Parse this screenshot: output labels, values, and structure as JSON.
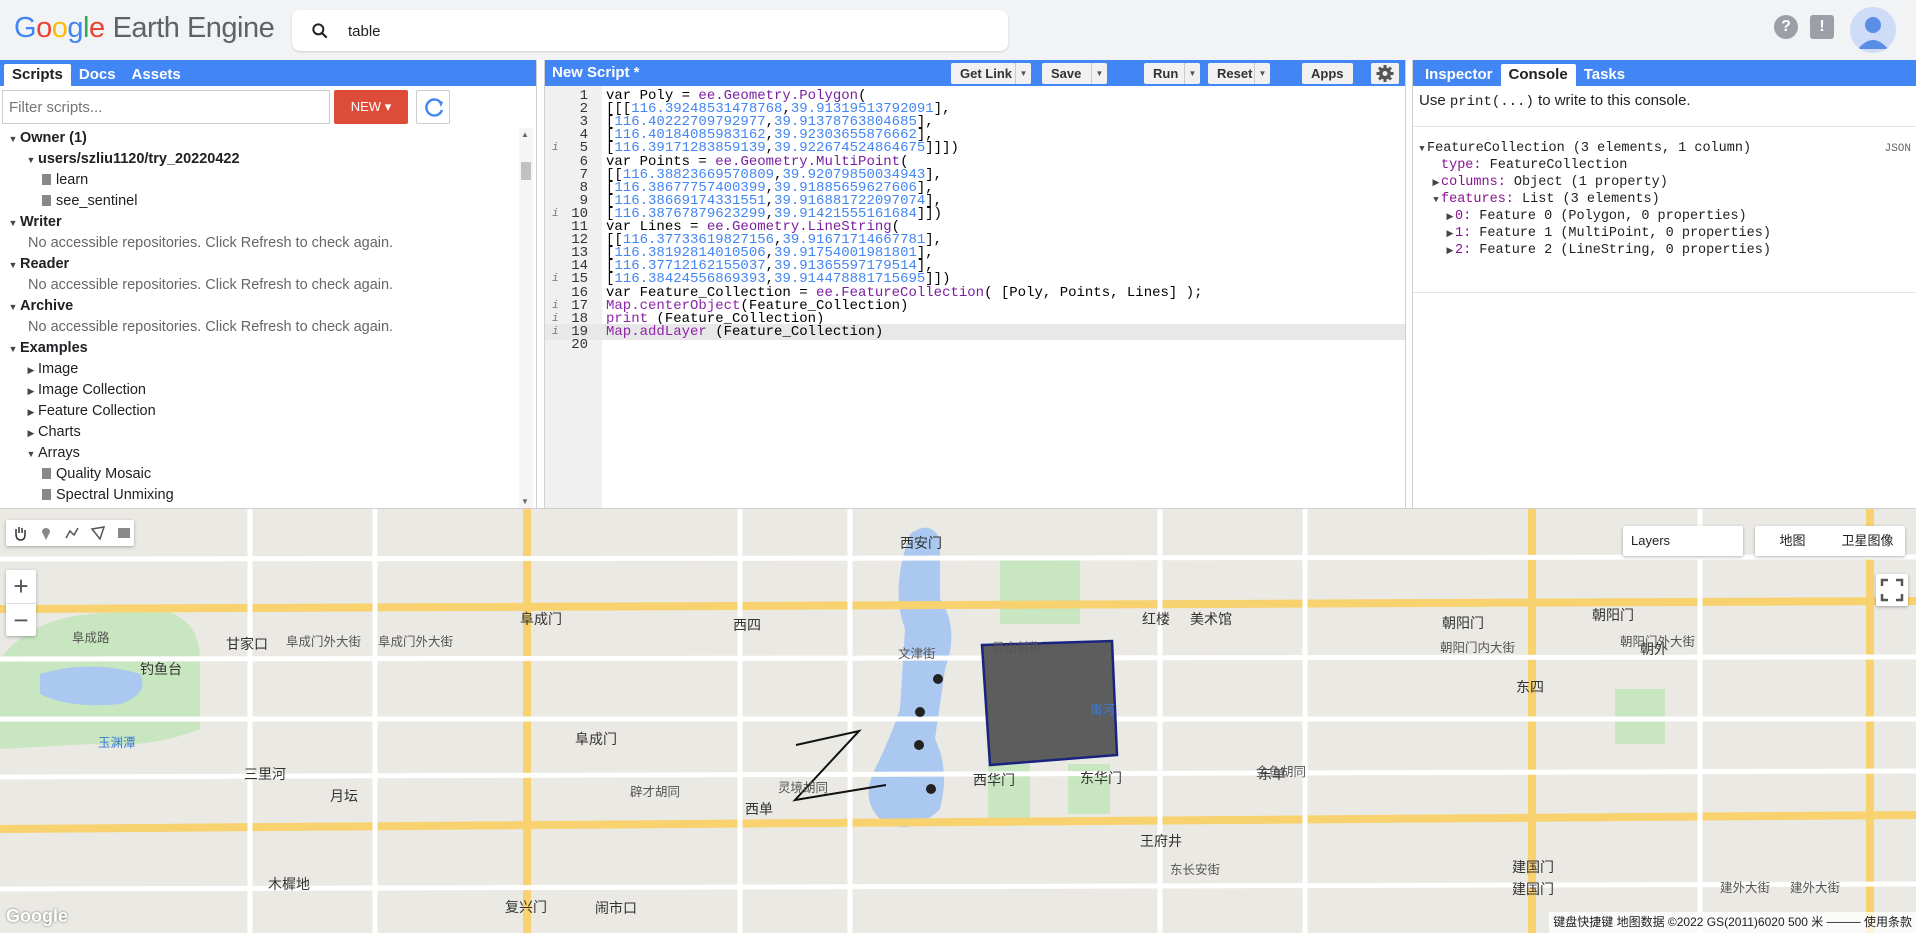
{
  "header": {
    "logo_google": [
      "G",
      "o",
      "o",
      "g",
      "l",
      "e"
    ],
    "logo_product": "Earth Engine",
    "search_value": "table"
  },
  "left_panel": {
    "tabs": [
      "Scripts",
      "Docs",
      "Assets"
    ],
    "filter_placeholder": "Filter scripts...",
    "new_button": "NEW",
    "tree": [
      {
        "label": "Owner (1)",
        "level": 0,
        "icon": "open",
        "bold": true
      },
      {
        "label": "users/szliu1120/try_20220422",
        "level": 1,
        "icon": "open",
        "bold": true
      },
      {
        "label": "learn",
        "level": 2,
        "icon": "file"
      },
      {
        "label": "see_sentinel",
        "level": 2,
        "icon": "file"
      },
      {
        "label": "Writer",
        "level": 0,
        "icon": "open",
        "bold": true
      },
      {
        "label": "No accessible repositories. Click Refresh to check again.",
        "level": 1,
        "icon": "none",
        "muted": true
      },
      {
        "label": "Reader",
        "level": 0,
        "icon": "open",
        "bold": true
      },
      {
        "label": "No accessible repositories. Click Refresh to check again.",
        "level": 1,
        "icon": "none",
        "muted": true
      },
      {
        "label": "Archive",
        "level": 0,
        "icon": "open",
        "bold": true
      },
      {
        "label": "No accessible repositories. Click Refresh to check again.",
        "level": 1,
        "icon": "none",
        "muted": true
      },
      {
        "label": "Examples",
        "level": 0,
        "icon": "open",
        "bold": true
      },
      {
        "label": "Image",
        "level": 1,
        "icon": "closed"
      },
      {
        "label": "Image Collection",
        "level": 1,
        "icon": "closed"
      },
      {
        "label": "Feature Collection",
        "level": 1,
        "icon": "closed"
      },
      {
        "label": "Charts",
        "level": 1,
        "icon": "closed"
      },
      {
        "label": "Arrays",
        "level": 1,
        "icon": "open"
      },
      {
        "label": "Quality Mosaic",
        "level": 2,
        "icon": "file"
      },
      {
        "label": "Spectral Unmixing",
        "level": 2,
        "icon": "file"
      }
    ]
  },
  "editor": {
    "title": "New Script *",
    "buttons": {
      "get_link": "Get Link",
      "save": "Save",
      "run": "Run",
      "reset": "Reset",
      "apps": "Apps"
    },
    "lines": [
      {
        "n": "1",
        "info": false,
        "segs": [
          [
            "kw",
            "var "
          ],
          [
            "txt",
            "Poly = "
          ],
          [
            "purple",
            "ee.Geometry.Polygon"
          ],
          [
            "txt",
            "("
          ]
        ]
      },
      {
        "n": "2",
        "info": false,
        "segs": [
          [
            "txt",
            "[[["
          ],
          [
            "blue",
            "116.39248531478768"
          ],
          [
            "txt",
            ","
          ],
          [
            "blue",
            "39.91319513792091"
          ],
          [
            "txt",
            "],"
          ]
        ]
      },
      {
        "n": "3",
        "info": false,
        "segs": [
          [
            "txt",
            "["
          ],
          [
            "blue",
            "116.40222709792977"
          ],
          [
            "txt",
            ","
          ],
          [
            "blue",
            "39.91378763804685"
          ],
          [
            "txt",
            "],"
          ]
        ]
      },
      {
        "n": "4",
        "info": false,
        "segs": [
          [
            "txt",
            "["
          ],
          [
            "blue",
            "116.40184085983162"
          ],
          [
            "txt",
            ","
          ],
          [
            "blue",
            "39.92303655876662"
          ],
          [
            "txt",
            "],"
          ]
        ]
      },
      {
        "n": "5",
        "info": true,
        "segs": [
          [
            "txt",
            "["
          ],
          [
            "blue",
            "116.39171283859139"
          ],
          [
            "txt",
            ","
          ],
          [
            "blue",
            "39.922674524864675"
          ],
          [
            "txt",
            "]]])"
          ]
        ]
      },
      {
        "n": "6",
        "info": false,
        "segs": [
          [
            "kw",
            "var "
          ],
          [
            "txt",
            "Points = "
          ],
          [
            "purple",
            "ee.Geometry.MultiPoint"
          ],
          [
            "txt",
            "("
          ]
        ]
      },
      {
        "n": "7",
        "info": false,
        "segs": [
          [
            "txt",
            "[["
          ],
          [
            "blue",
            "116.38823669570809"
          ],
          [
            "txt",
            ","
          ],
          [
            "blue",
            "39.92079850034943"
          ],
          [
            "txt",
            "],"
          ]
        ]
      },
      {
        "n": "8",
        "info": false,
        "segs": [
          [
            "txt",
            "["
          ],
          [
            "blue",
            "116.38677757400399"
          ],
          [
            "txt",
            ","
          ],
          [
            "blue",
            "39.91885659627606"
          ],
          [
            "txt",
            "],"
          ]
        ]
      },
      {
        "n": "9",
        "info": false,
        "segs": [
          [
            "txt",
            "["
          ],
          [
            "blue",
            "116.38669174331551"
          ],
          [
            "txt",
            ","
          ],
          [
            "blue",
            "39.916881722097074"
          ],
          [
            "txt",
            "],"
          ]
        ]
      },
      {
        "n": "10",
        "info": true,
        "segs": [
          [
            "txt",
            "["
          ],
          [
            "blue",
            "116.38767879623299"
          ],
          [
            "txt",
            ","
          ],
          [
            "blue",
            "39.91421555161684"
          ],
          [
            "txt",
            "]])"
          ]
        ]
      },
      {
        "n": "11",
        "info": false,
        "segs": [
          [
            "kw",
            "var "
          ],
          [
            "txt",
            "Lines = "
          ],
          [
            "purple",
            "ee.Geometry.LineString"
          ],
          [
            "txt",
            "("
          ]
        ]
      },
      {
        "n": "12",
        "info": false,
        "segs": [
          [
            "txt",
            "[["
          ],
          [
            "blue",
            "116.37733619827156"
          ],
          [
            "txt",
            ","
          ],
          [
            "blue",
            "39.91671714667781"
          ],
          [
            "txt",
            "],"
          ]
        ]
      },
      {
        "n": "13",
        "info": false,
        "segs": [
          [
            "txt",
            "["
          ],
          [
            "blue",
            "116.38192814010506"
          ],
          [
            "txt",
            ","
          ],
          [
            "blue",
            "39.91754001981801"
          ],
          [
            "txt",
            "],"
          ]
        ]
      },
      {
        "n": "14",
        "info": false,
        "segs": [
          [
            "txt",
            "["
          ],
          [
            "blue",
            "116.37712162155037"
          ],
          [
            "txt",
            ","
          ],
          [
            "blue",
            "39.91365597179514"
          ],
          [
            "txt",
            "],"
          ]
        ]
      },
      {
        "n": "15",
        "info": true,
        "segs": [
          [
            "txt",
            "["
          ],
          [
            "blue",
            "116.38424556869393"
          ],
          [
            "txt",
            ","
          ],
          [
            "blue",
            "39.914478881715695"
          ],
          [
            "txt",
            "]])"
          ]
        ]
      },
      {
        "n": "16",
        "info": false,
        "segs": [
          [
            "kw",
            "var "
          ],
          [
            "txt",
            "Feature_Collection = "
          ],
          [
            "purple",
            "ee.FeatureCollection"
          ],
          [
            "txt",
            "( [Poly, Points, Lines] );"
          ]
        ]
      },
      {
        "n": "17",
        "info": true,
        "segs": [
          [
            "fn",
            "Map.centerObject"
          ],
          [
            "txt",
            "(Feature_Collection)"
          ]
        ]
      },
      {
        "n": "18",
        "info": true,
        "segs": [
          [
            "fn",
            "print"
          ],
          [
            "txt",
            " (Feature_Collection)"
          ]
        ]
      },
      {
        "n": "19",
        "info": true,
        "segs": [
          [
            "fn",
            "Map.addLayer"
          ],
          [
            "txt",
            " (Feature_Collection)"
          ]
        ]
      },
      {
        "n": "20",
        "info": false,
        "segs": []
      }
    ],
    "active_line": "19"
  },
  "right_panel": {
    "tabs": [
      "Inspector",
      "Console",
      "Tasks"
    ],
    "hint_prefix": "Use ",
    "hint_code": "print(...)",
    "hint_suffix": " to write to this console.",
    "json_tag": "JSON",
    "output": [
      {
        "indent": 0,
        "tri": "open",
        "key": "",
        "text": "FeatureCollection (3 elements, 1 column)"
      },
      {
        "indent": 1,
        "tri": "none",
        "key": "type:",
        "text": " FeatureCollection"
      },
      {
        "indent": 1,
        "tri": "closed",
        "key": "columns:",
        "text": " Object (1 property)"
      },
      {
        "indent": 1,
        "tri": "open",
        "key": "features:",
        "text": " List (3 elements)"
      },
      {
        "indent": 2,
        "tri": "closed",
        "key": "0:",
        "text": " Feature 0 (Polygon, 0 properties)"
      },
      {
        "indent": 2,
        "tri": "closed",
        "key": "1:",
        "text": " Feature 1 (MultiPoint, 0 properties)"
      },
      {
        "indent": 2,
        "tri": "closed",
        "key": "2:",
        "text": " Feature 2 (LineString, 0 properties)"
      }
    ]
  },
  "map": {
    "layers_label": "Layers",
    "map_type_map": "地图",
    "map_type_satellite": "卫星图像",
    "google_watermark": "Google",
    "attribution": "键盘快捷键   地图数据 ©2022 GS(2011)6020   500 米 ────   使用条款",
    "labels": [
      {
        "t": "西安门",
        "big": true
      },
      {
        "t": "阜成门",
        "big": true
      },
      {
        "t": "西四",
        "big": true
      },
      {
        "t": "红楼",
        "big": true
      },
      {
        "t": "美术馆",
        "big": true
      },
      {
        "t": "朝阳门",
        "big": true
      },
      {
        "t": "朝阳门",
        "big": true
      },
      {
        "t": "甘家口",
        "big": true
      },
      {
        "t": "钓鱼台",
        "big": true
      },
      {
        "t": "玉渊潭",
        "big": false,
        "water": true
      },
      {
        "t": "阜成路",
        "big": false
      },
      {
        "t": "阜成门外大街",
        "big": false
      },
      {
        "t": "阜成门外大街",
        "big": false
      },
      {
        "t": "三里河",
        "big": true
      },
      {
        "t": "月坛",
        "big": true
      },
      {
        "t": "阜成门",
        "big": true
      },
      {
        "t": "西单",
        "big": true
      },
      {
        "t": "西华门",
        "big": true
      },
      {
        "t": "东华门",
        "big": true
      },
      {
        "t": "东单",
        "big": true
      },
      {
        "t": "王府井",
        "big": true
      },
      {
        "t": "复兴门",
        "big": true
      },
      {
        "t": "闹市口",
        "big": true
      },
      {
        "t": "木樨地",
        "big": true
      },
      {
        "t": "建国门",
        "big": true
      },
      {
        "t": "建国门",
        "big": true
      },
      {
        "t": "朝外",
        "big": true
      },
      {
        "t": "东四",
        "big": true
      },
      {
        "t": "南河",
        "big": false,
        "water": true
      },
      {
        "t": "文津街",
        "big": false
      },
      {
        "t": "景山前街",
        "big": false
      },
      {
        "t": "朝阳门外大街",
        "big": false
      },
      {
        "t": "朝阳门内大街",
        "big": false
      },
      {
        "t": "建外大街",
        "big": false
      },
      {
        "t": "建外大街",
        "big": false
      },
      {
        "t": "金鱼胡同",
        "big": false
      },
      {
        "t": "东长安街",
        "big": false
      },
      {
        "t": "灵境胡同",
        "big": false
      },
      {
        "t": "辟才胡同",
        "big": false
      }
    ]
  },
  "colors": {
    "brand_blue": "#4285f4",
    "new_red": "#dd4b39",
    "polygon_fill": "#555555"
  }
}
